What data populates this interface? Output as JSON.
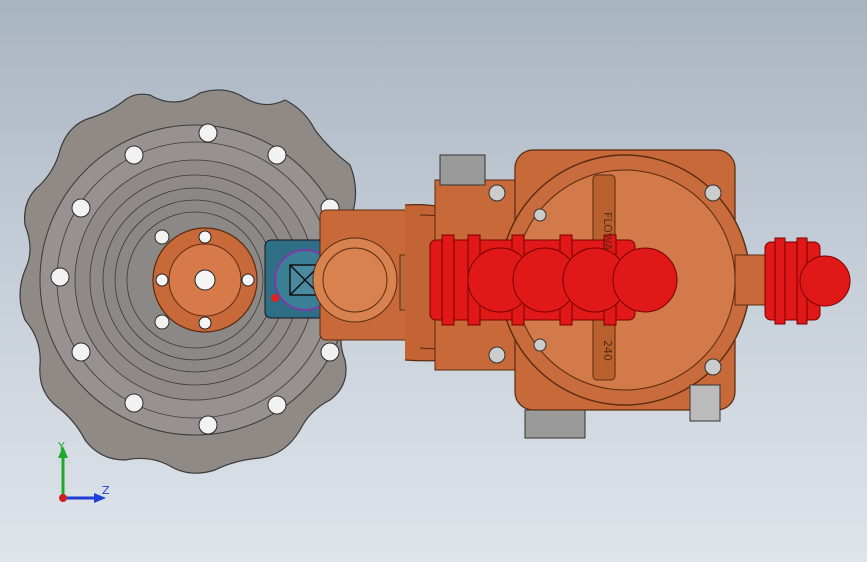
{
  "app": {
    "title": ""
  },
  "model": {
    "engraving_top": "FLOWA",
    "engraving_bottom": "240",
    "colors": {
      "background_top": "#a9b4c1",
      "background_bottom": "#dfe4ea",
      "flange": "#8f8a86",
      "copper": "#c8693a",
      "copper_dark": "#8a3f1c",
      "red_bellows": "#e01818",
      "teal_block": "#2f6f86"
    }
  },
  "triad": {
    "y_label": "Y",
    "z_label": "Z",
    "colors": {
      "y": "#1faa2e",
      "z": "#1f3fd6",
      "x": "#d11e1e"
    }
  }
}
